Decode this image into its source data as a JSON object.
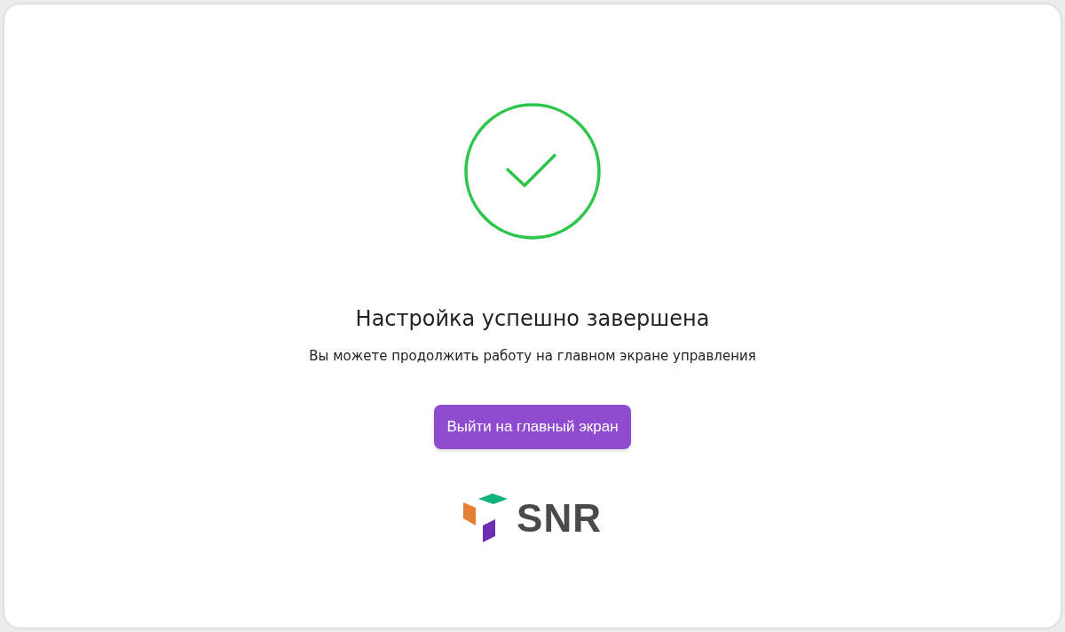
{
  "title": "Настройка успешно завершена",
  "message": "Вы можете продолжить работу на главном экране управления",
  "button": {
    "label": "Выйти на главный экран"
  },
  "logo": {
    "text": "SNR"
  }
}
